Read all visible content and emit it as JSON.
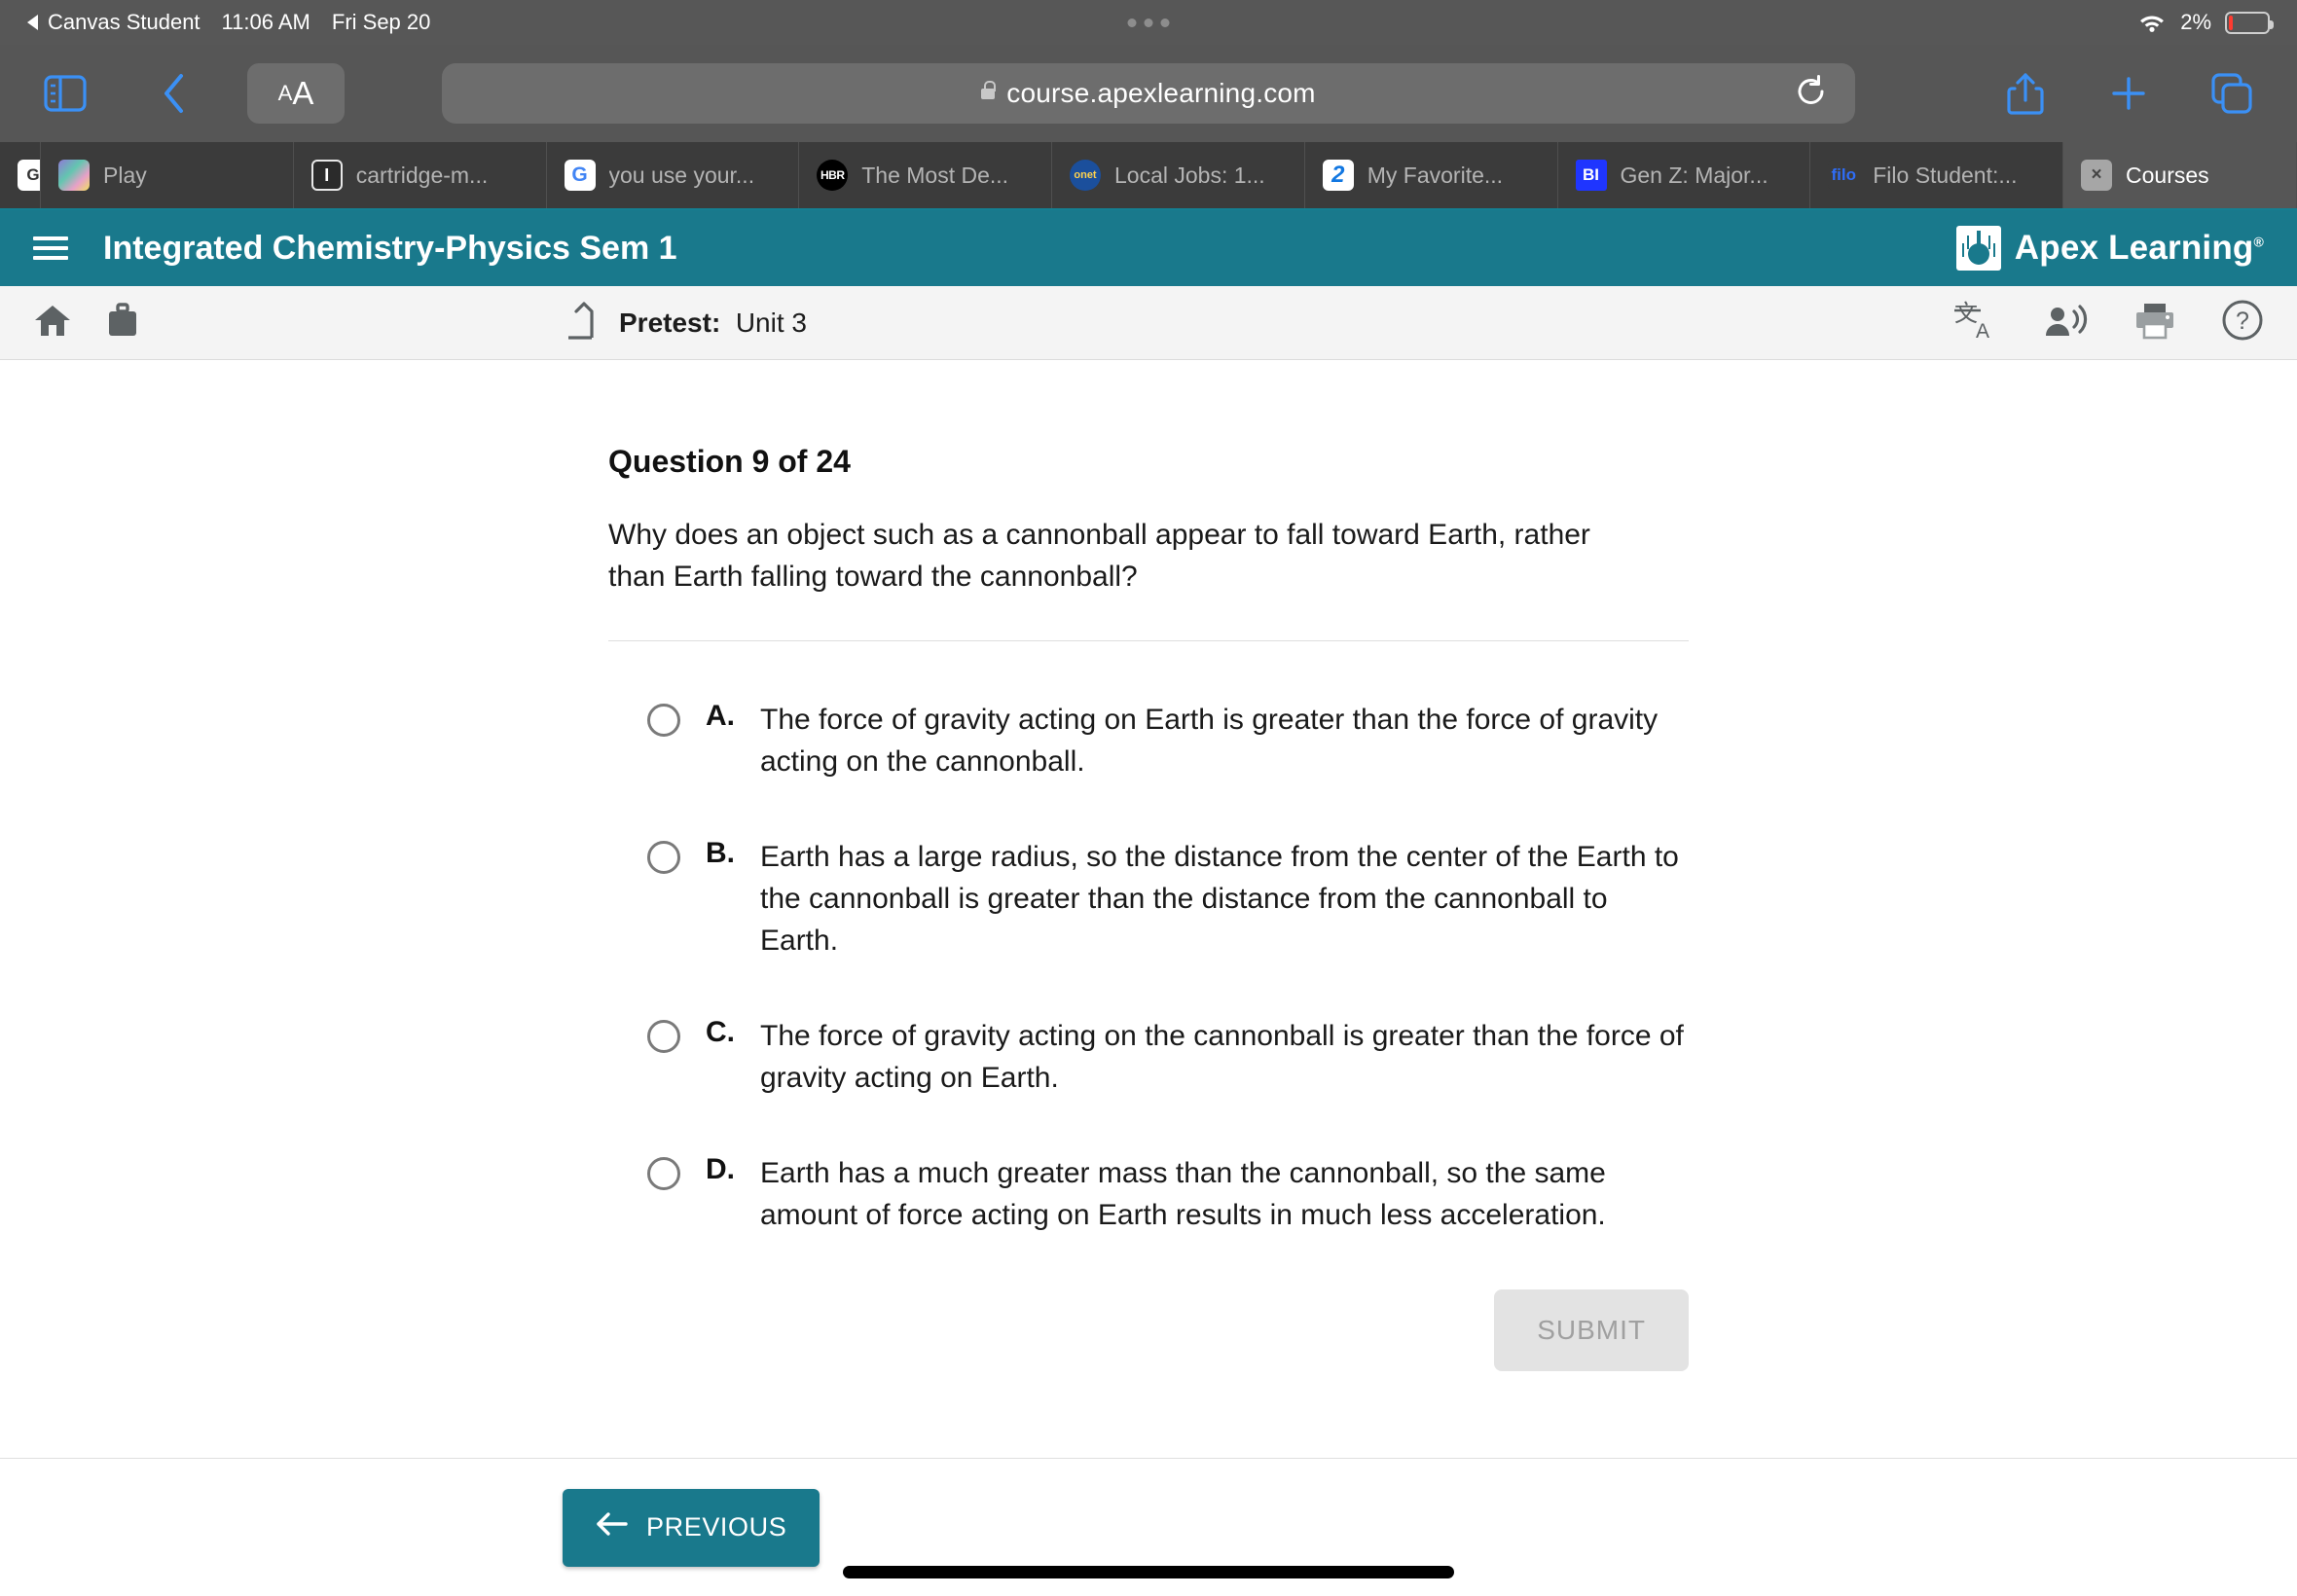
{
  "status_bar": {
    "app_name": "Canvas Student",
    "time": "11:06 AM",
    "date": "Fri Sep 20",
    "battery_percent": "2%",
    "wifi_icon": "wifi-icon",
    "battery_icon": "battery-low-icon"
  },
  "browser": {
    "sidebar_icon": "sidebar-icon",
    "back_icon": "chevron-left-icon",
    "forward_icon": "chevron-right-icon",
    "text_size_small": "A",
    "text_size_large": "A",
    "url": "course.apexlearning.com",
    "lock_icon": "lock-icon",
    "reload_icon": "reload-icon",
    "share_icon": "share-icon",
    "new_tab_icon": "plus-icon",
    "tabs_overview_icon": "tabs-overview-icon",
    "tabs": [
      {
        "label": "",
        "favicon": "g-icon",
        "favicon_text": "G",
        "favicon_class": "fav-g",
        "active": false
      },
      {
        "label": "Play ",
        "favicon": "play-icon",
        "favicon_text": "",
        "favicon_class": "fav-play",
        "active": false
      },
      {
        "label": "cartridge-m...",
        "favicon": "instructure-icon",
        "favicon_text": "I",
        "favicon_class": "fav-i",
        "active": false
      },
      {
        "label": "you use your...",
        "favicon": "google-icon",
        "favicon_text": "G",
        "favicon_class": "fav-goog",
        "active": false
      },
      {
        "label": "The Most De...",
        "favicon": "hbr-icon",
        "favicon_text": "HBR",
        "favicon_class": "fav-hbr",
        "active": false
      },
      {
        "label": "Local Jobs: 1...",
        "favicon": "onet-icon",
        "favicon_text": "onet",
        "favicon_class": "fav-onet",
        "active": false
      },
      {
        "label": "My Favorite...",
        "favicon": "zillow-icon",
        "favicon_text": "2",
        "favicon_class": "fav-z",
        "active": false
      },
      {
        "label": "Gen Z: Major...",
        "favicon": "business-insider-icon",
        "favicon_text": "BI",
        "favicon_class": "fav-bi",
        "active": false
      },
      {
        "label": "Filo Student:...",
        "favicon": "filo-icon",
        "favicon_text": "filo",
        "favicon_class": "fav-filo",
        "active": false
      },
      {
        "label": "Courses",
        "favicon": "close-icon",
        "favicon_text": "×",
        "favicon_class": "fav-x",
        "active": true
      }
    ]
  },
  "app_header": {
    "menu_icon": "list-menu-icon",
    "course_title": "Integrated Chemistry-Physics Sem 1",
    "brand_name": "Apex Learning",
    "brand_registered": "®",
    "brand_logo": "apex-sunburst-logo",
    "background_color": "#19798c"
  },
  "sub_toolbar": {
    "home_icon": "home-icon",
    "briefcase_icon": "briefcase-icon",
    "level_up_icon": "level-up-icon",
    "breadcrumb_label": "Pretest:",
    "breadcrumb_value": "Unit 3",
    "translate_icon": "translate-icon",
    "read_aloud_icon": "read-aloud-icon",
    "print_icon": "print-icon",
    "help_icon": "help-circle-icon"
  },
  "question": {
    "number_label": "Question 9 of 24",
    "prompt": "Why does an object such as a cannonball appear to fall toward Earth, rather than Earth falling toward the cannonball?",
    "options": [
      {
        "letter": "A.",
        "text": "The force of gravity acting on Earth is greater than the force of gravity acting on the cannonball.",
        "selected": false
      },
      {
        "letter": "B.",
        "text": "Earth has a large radius, so the distance from the center of the Earth to the cannonball is greater than the distance from the cannonball to Earth.",
        "selected": false
      },
      {
        "letter": "C.",
        "text": "The force of gravity acting on the cannonball is greater than the force of gravity acting on Earth.",
        "selected": false
      },
      {
        "letter": "D.",
        "text": "Earth has a much greater mass than the cannonball, so the same amount of force acting on Earth results in much less acceleration.",
        "selected": false
      }
    ],
    "submit_label": "SUBMIT",
    "submit_disabled": true
  },
  "footer": {
    "previous_label": "PREVIOUS",
    "previous_icon": "arrow-left-icon",
    "home_indicator": "home-indicator"
  },
  "colors": {
    "accent_teal": "#19798c",
    "browser_chrome": "#565656",
    "tab_strip": "#3b3b3b",
    "submit_disabled_bg": "#e3e3e3"
  }
}
